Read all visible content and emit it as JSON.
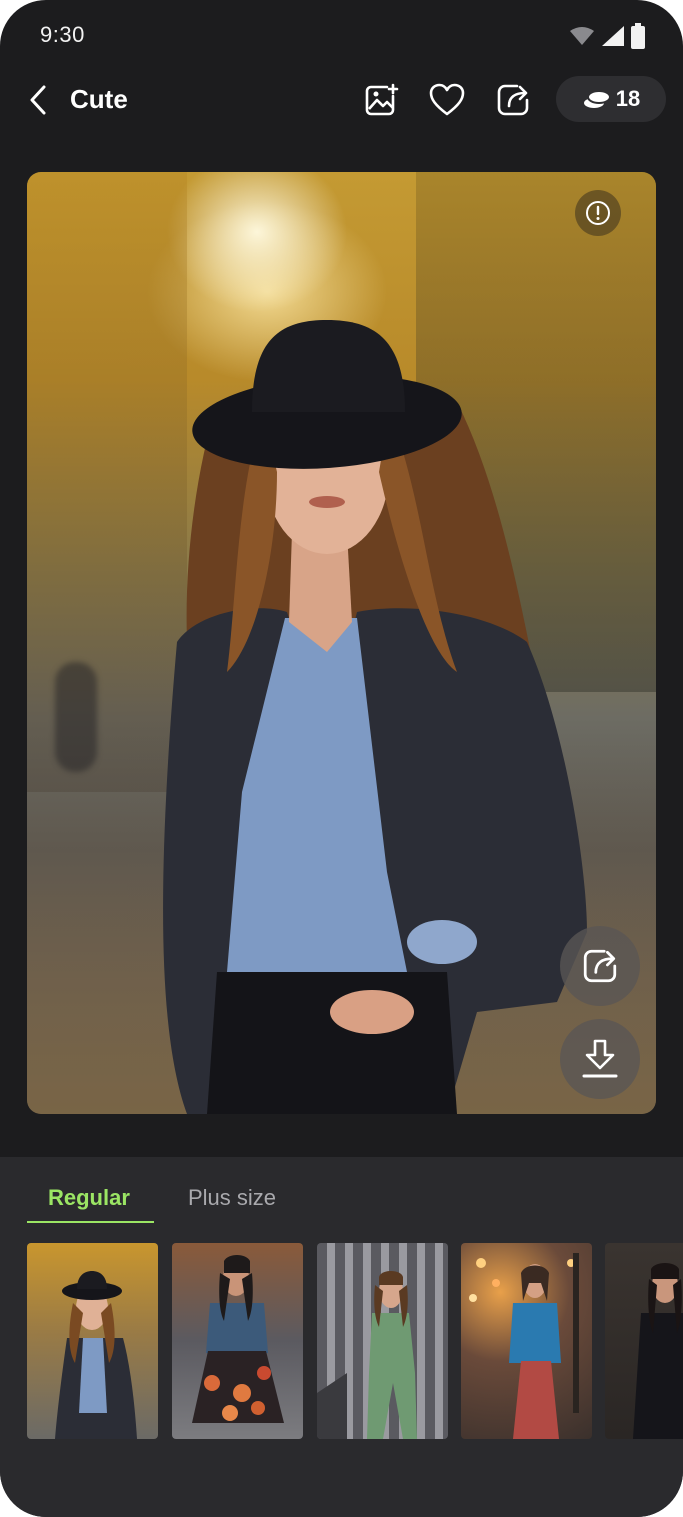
{
  "status_bar": {
    "time": "9:30"
  },
  "header": {
    "title": "Cute",
    "credits_count": "18",
    "icons": [
      "chevron-left-icon",
      "add-image-icon",
      "heart-icon",
      "share-icon",
      "coins-icon"
    ]
  },
  "photo": {
    "alt": "Woman in black hat and denim jacket on autumn street",
    "actions": [
      "info-icon",
      "share-icon",
      "download-icon"
    ]
  },
  "tabs": [
    {
      "label": "Regular",
      "selected": true
    },
    {
      "label": "Plus size",
      "selected": false
    }
  ],
  "thumbnails": [
    {
      "desc": "Woman in hat and denim jacket, autumn street"
    },
    {
      "desc": "Woman in denim jacket and floral skirt"
    },
    {
      "desc": "Woman in green jumpsuit by striped wall"
    },
    {
      "desc": "Woman in blue blazer and red skirt, evening street"
    },
    {
      "desc": "Woman in black outfit, dark setting"
    }
  ],
  "colors": {
    "background": "#1c1c1e",
    "panel": "#2a2a2d",
    "accent": "#9be564",
    "inactive_tab": "#a9a9ad"
  }
}
